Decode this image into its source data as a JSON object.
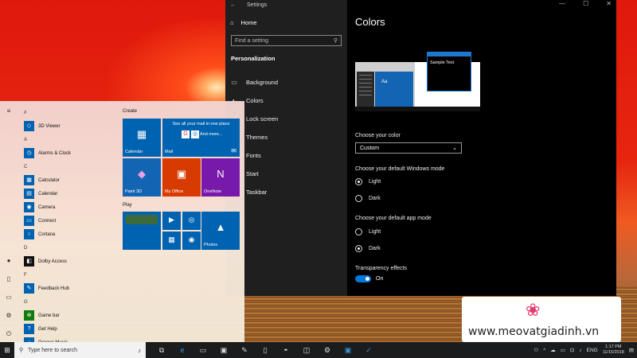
{
  "settings": {
    "window_title": "Settings",
    "home_label": "Home",
    "search_placeholder": "Find a setting",
    "section_title": "Personalization",
    "nav_items": [
      {
        "label": "Background",
        "icon": "image-icon"
      },
      {
        "label": "Colors",
        "icon": "palette-icon"
      },
      {
        "label": "Lock screen",
        "icon": "monitor-icon"
      },
      {
        "label": "Themes",
        "icon": "brush-icon"
      },
      {
        "label": "Fonts",
        "icon": "font-icon"
      },
      {
        "label": "Start",
        "icon": "start-icon"
      },
      {
        "label": "Taskbar",
        "icon": "taskbar-icon"
      }
    ],
    "page_title": "Colors",
    "preview_tile_text": "Aa",
    "sample_text": "Sample Text",
    "choose_color_label": "Choose your color",
    "choose_color_value": "Custom",
    "windows_mode_label": "Choose your default Windows mode",
    "windows_mode_options": [
      "Light",
      "Dark"
    ],
    "windows_mode_selected": "Light",
    "app_mode_label": "Choose your default app mode",
    "app_mode_options": [
      "Light",
      "Dark"
    ],
    "app_mode_selected": "Dark",
    "transparency_label": "Transparency effects",
    "transparency_state": "On",
    "accent_color": "#0078d7"
  },
  "start_menu": {
    "rail_icons": [
      "hamburger-icon",
      "user-icon",
      "document-icon",
      "pictures-icon",
      "settings-icon",
      "power-icon"
    ],
    "app_groups": [
      {
        "letter": "#",
        "apps": [
          {
            "name": "3D Viewer",
            "style": "blue"
          }
        ]
      },
      {
        "letter": "A",
        "apps": [
          {
            "name": "Alarms & Clock",
            "style": "blue"
          }
        ]
      },
      {
        "letter": "C",
        "apps": [
          {
            "name": "Calculator",
            "style": "blue"
          },
          {
            "name": "Calendar",
            "style": "blue"
          },
          {
            "name": "Camera",
            "style": "blue"
          },
          {
            "name": "Connect",
            "style": "blue"
          },
          {
            "name": "Cortana",
            "style": "blue"
          }
        ]
      },
      {
        "letter": "D",
        "apps": [
          {
            "name": "Dolby Access",
            "style": "dark"
          }
        ]
      },
      {
        "letter": "F",
        "apps": [
          {
            "name": "Feedback Hub",
            "style": "blue"
          }
        ]
      },
      {
        "letter": "G",
        "apps": [
          {
            "name": "Game bar",
            "style": "green"
          },
          {
            "name": "Get Help",
            "style": "blue"
          },
          {
            "name": "Groove Music",
            "style": "blue"
          }
        ]
      }
    ],
    "create_title": "Create",
    "play_title": "Play",
    "mail_tile_text": "See all your mail in one place",
    "mail_more": "And more...",
    "tiles": {
      "calendar": "Calendar",
      "mail": "Mail",
      "paint3d": "Paint 3D",
      "myoffice": "My Office",
      "onenote": "OneNote",
      "photos": "Photos"
    }
  },
  "taskbar": {
    "search_placeholder": "Type here to search",
    "language": "ENG",
    "time": "1:17 PM",
    "date": "11/15/2018"
  },
  "watermark": {
    "text": "www.meovatgiadinh.vn"
  }
}
